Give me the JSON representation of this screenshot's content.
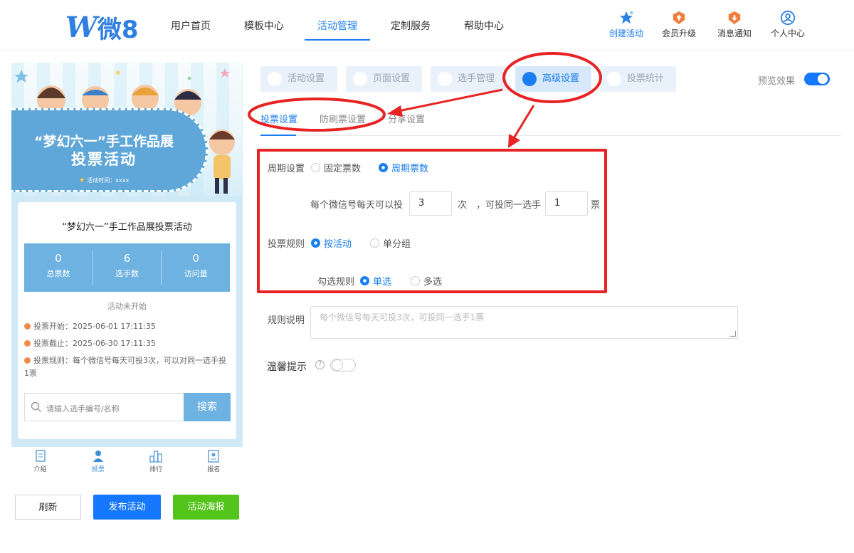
{
  "brand": {
    "logo_text": "微8"
  },
  "nav": {
    "items": [
      "用户首页",
      "模板中心",
      "活动管理",
      "定制服务",
      "帮助中心"
    ],
    "active_index": 2,
    "right": {
      "create": "创建活动",
      "upgrade": "会员升级",
      "messages": "消息通知",
      "profile": "个人中心"
    }
  },
  "preview": {
    "banner_title_line1": "“梦幻六一”手工作品展",
    "banner_title_line2": "投票活动",
    "banner_time": "活动时间：xxxx",
    "activity_title": "“梦幻六一”手工作品展投票活动",
    "stats": [
      {
        "value": "0",
        "label": "总票数"
      },
      {
        "value": "6",
        "label": "选手数"
      },
      {
        "value": "0",
        "label": "访问量"
      }
    ],
    "status": "活动未开始",
    "rules": {
      "start": "投票开始：2025-06-01 17:11:35",
      "end": "投票截止：2025-06-30 17:11:35",
      "rule": "投票规则：每个微信号每天可投3次，可以对同一选手投1票"
    },
    "search": {
      "placeholder": "请输入选手编号/名称",
      "button": "搜索"
    },
    "tabbar": [
      "介绍",
      "投票",
      "排行",
      "报名"
    ],
    "tabbar_active_index": 1
  },
  "actions": {
    "refresh": "刷新",
    "publish": "发布活动",
    "poster": "活动海报"
  },
  "settings": {
    "tabs": [
      "活动设置",
      "页面设置",
      "选手管理",
      "高级设置",
      "投票统计"
    ],
    "active_tab_index": 3,
    "preview_label": "预览效果",
    "preview_on": true,
    "subtabs": [
      "投票设置",
      "防刷票设置",
      "分享设置"
    ],
    "active_subtab_index": 0,
    "form": {
      "period": {
        "label": "周期设置",
        "options": [
          "固定票数",
          "周期票数"
        ],
        "selected": "周期票数"
      },
      "daily": {
        "prefix": "每个微信号每天可以投",
        "times_value": "3",
        "times_unit": "次",
        "same_player_prefix": "，可投同一选手",
        "votes_value": "1",
        "votes_unit": "票"
      },
      "rule": {
        "label": "投票规则",
        "options": [
          "按活动",
          "单分组"
        ],
        "selected": "按活动"
      },
      "select_rule": {
        "label": "勾选规则",
        "options": [
          "单选",
          "多选"
        ],
        "selected": "单选"
      },
      "description": {
        "label": "规则说明",
        "placeholder": "每个微信号每天可投3次，可投同一选手1票"
      },
      "tips": {
        "label": "温馨提示",
        "help": "?",
        "on": false
      }
    }
  },
  "colors": {
    "accent": "#1a7ef0",
    "annotation": "#e82323",
    "publish": "#1677ff",
    "poster": "#52c41a",
    "preview_blue": "#6eb2e1"
  }
}
